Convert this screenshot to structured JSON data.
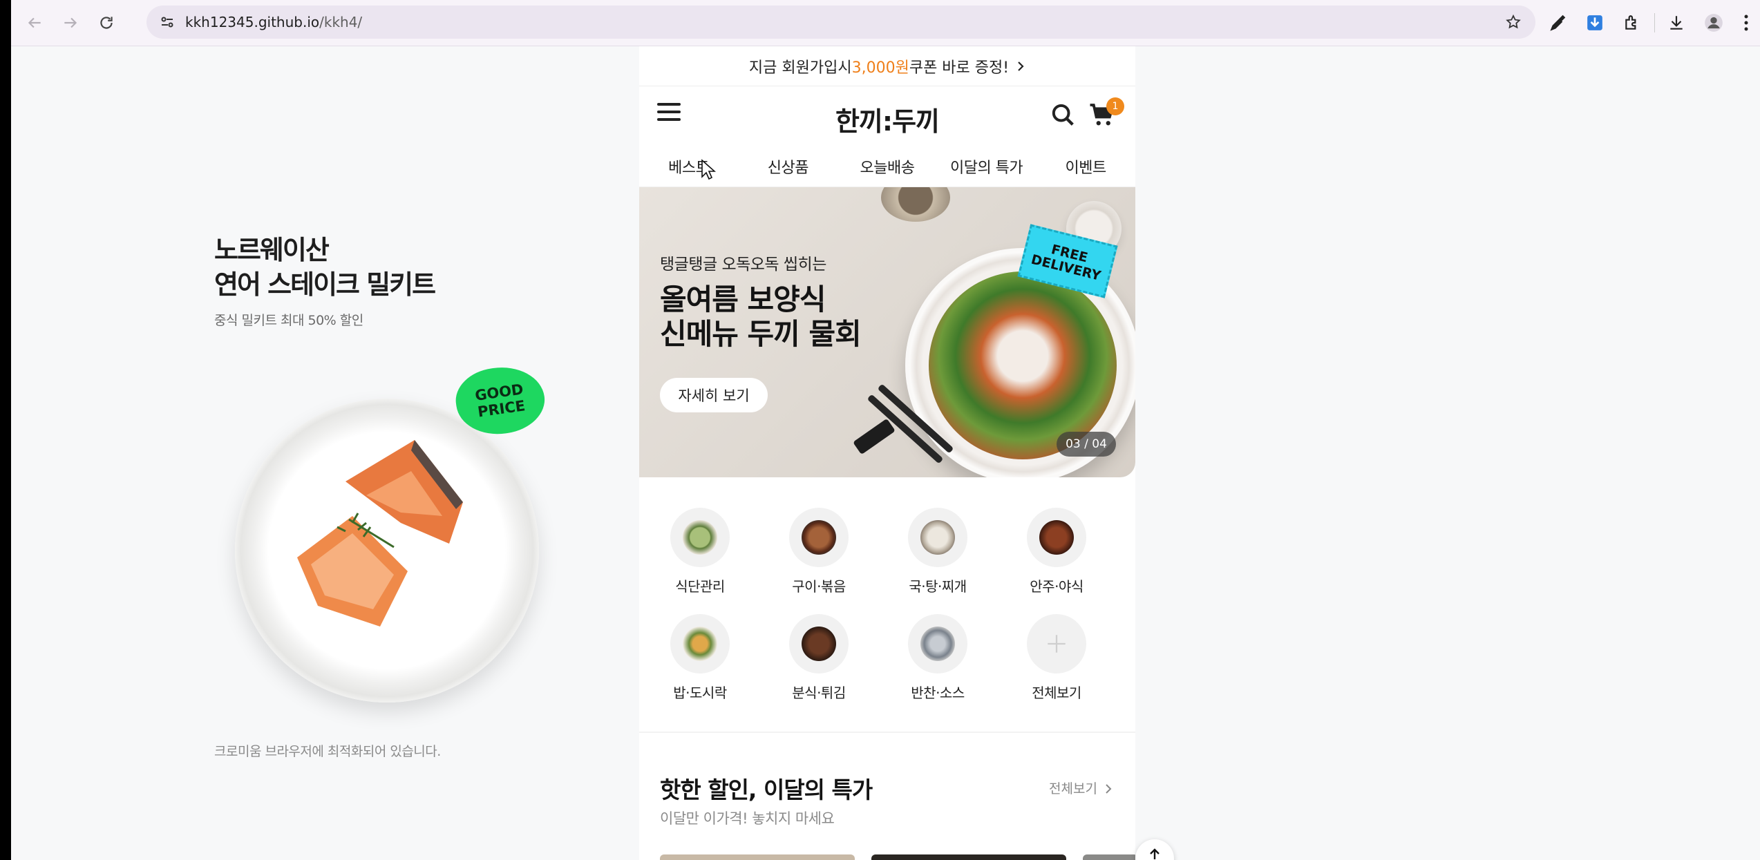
{
  "browser": {
    "url_host": "kkh12345.github.io",
    "url_path": "/kkh4/",
    "icons": [
      "back-icon",
      "forward-icon",
      "reload-icon",
      "site-info-icon",
      "bookmark-star-icon",
      "eyedropper-icon",
      "download-extension-icon",
      "extensions-icon",
      "downloads-icon",
      "profile-icon",
      "menu-icon"
    ]
  },
  "promo": {
    "title_line1": "노르웨이산",
    "title_line2": "연어 스테이크 밀키트",
    "subtitle": "중식 밀키트 최대 50% 할인",
    "badge_line1": "GOOD",
    "badge_line2": "PRICE",
    "note": "크로미움 브라우저에 최적화되어 있습니다."
  },
  "topbar": {
    "prefix": "지금 회원가입시 ",
    "amount": "3,000원",
    "suffix": " 쿠폰 바로 증정!"
  },
  "header": {
    "logo": "한끼:두끼",
    "cart_count": "1"
  },
  "gnb": [
    "베스트",
    "신상품",
    "오늘배송",
    "이달의 특가",
    "이벤트"
  ],
  "banner": {
    "eyebrow": "탱글탱글 오독오독 씹히는",
    "headline_line1": "올여름 보양식",
    "headline_line2": "신메뉴 두끼 물회",
    "cta": "자세히 보기",
    "badge_line1": "FREE",
    "badge_line2": "DELIVERY",
    "counter": "03 / 04"
  },
  "categories": [
    {
      "label": "식단관리",
      "color": "#7b9a56"
    },
    {
      "label": "구이·볶음",
      "color": "#6b3a22"
    },
    {
      "label": "국·탕·찌개",
      "color": "#c9c2b6"
    },
    {
      "label": "안주·야식",
      "color": "#4a2516"
    },
    {
      "label": "밥·도시락",
      "color": "#c99a4a"
    },
    {
      "label": "분식·튀김",
      "color": "#3b2218"
    },
    {
      "label": "반찬·소스",
      "color": "#9aa0a8"
    },
    {
      "label": "전체보기",
      "color": "#f3f3f3"
    }
  ],
  "section": {
    "title": "핫한 할인, 이달의 특가",
    "subtitle": "이달만 이가격! 놓치지 마세요",
    "more": "전체보기"
  },
  "colors": {
    "accent_orange": "#ef7f1a",
    "good_price_green": "#1ed760",
    "free_delivery_cyan": "#33d6f0"
  }
}
